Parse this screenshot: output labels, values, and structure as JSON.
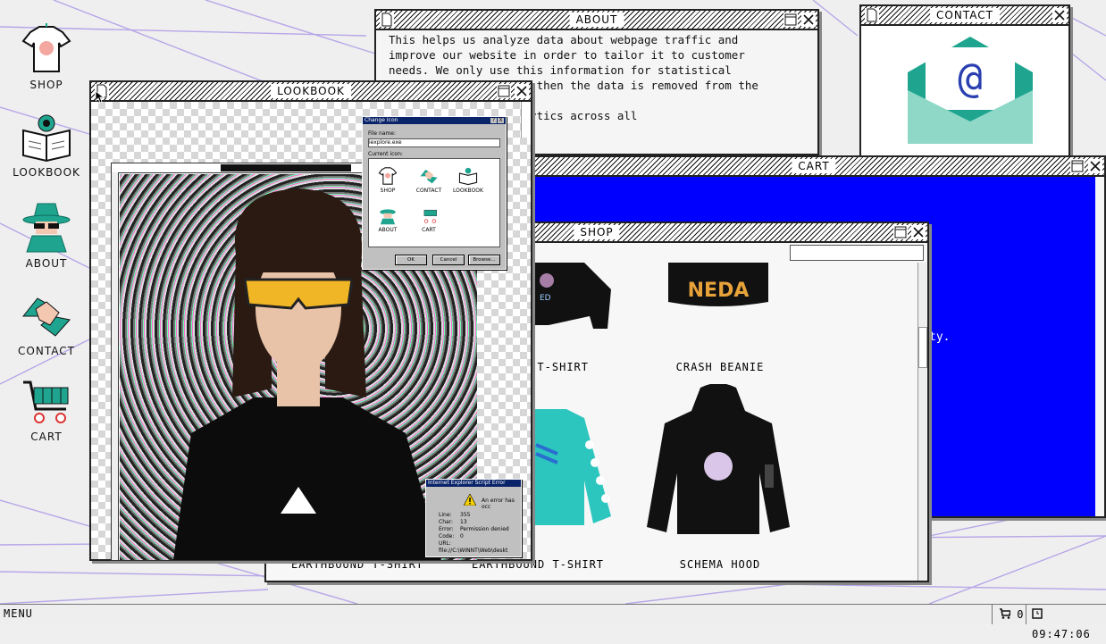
{
  "desktop": {
    "icons": [
      {
        "label": "SHOP",
        "icon": "tshirt-icon"
      },
      {
        "label": "LOOKBOOK",
        "icon": "book-eye-icon"
      },
      {
        "label": "ABOUT",
        "icon": "spy-icon"
      },
      {
        "label": "CONTACT",
        "icon": "handshake-icon"
      },
      {
        "label": "CART",
        "icon": "cart-icon"
      }
    ]
  },
  "windows": {
    "about": {
      "title": "ABOUT",
      "text": "This helps us analyze data about webpage traffic and\nimprove our website in order to tailor it to customer\nneeds. We only use this information for statistical\nanalysis purposes and then the data is removed from the\n\n                   racked by Google Analytics across all"
    },
    "contact": {
      "title": "CONTACT"
    },
    "cart": {
      "title": "CART",
      "text_fragment": "ty."
    },
    "shop": {
      "title": "SHOP",
      "search_value": "",
      "products": [
        {
          "name": "R T-SHIRT"
        },
        {
          "name": "CRASH BEANIE"
        },
        {
          "name": "EARTHBOUND T-SHIRT"
        },
        {
          "name": "EARTHBOUND T-SHIRT"
        },
        {
          "name": "SCHEMA HOOD"
        }
      ]
    },
    "lookbook": {
      "title": "LOOKBOOK"
    }
  },
  "change_icon_dialog": {
    "title": "Change Icon",
    "file_label": "File name:",
    "file_value": "iexplore.exe",
    "current_label": "Current icon:",
    "icons": [
      "SHOP",
      "CONTACT",
      "LOOKBOOK",
      "ABOUT",
      "CART"
    ],
    "ok": "OK",
    "cancel": "Cancel",
    "browse": "Browse...",
    "help": "?",
    "close": "X"
  },
  "ie_error": {
    "title": "Internet Explorer Script Error",
    "message": "An error has occ",
    "rows": [
      {
        "k": "Line:",
        "v": "355"
      },
      {
        "k": "Char:",
        "v": "13"
      },
      {
        "k": "Error:",
        "v": "Permission denied"
      },
      {
        "k": "Code:",
        "v": "0"
      },
      {
        "k": "URL:",
        "v": "file://C:\\WINNT\\Web\\deskt"
      }
    ]
  },
  "taskbar": {
    "menu": "MENU",
    "cart_count": "0",
    "clock": "09:47:06"
  },
  "colors": {
    "cart_blue": "#0000ff",
    "accent_teal": "#1fa58f",
    "titlebar_stripe": "#111111"
  }
}
